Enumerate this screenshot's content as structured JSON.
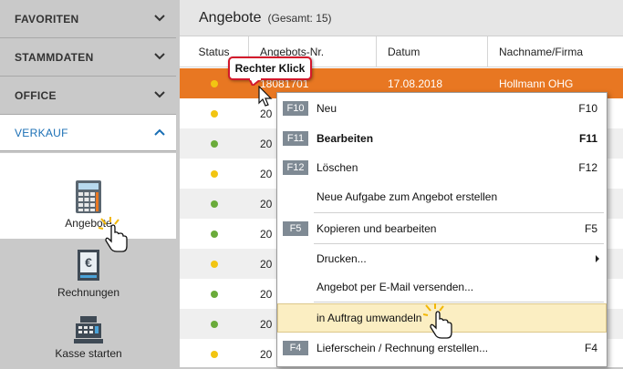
{
  "sidebar": {
    "sections": [
      {
        "label": "FAVORITEN"
      },
      {
        "label": "STAMMDATEN"
      },
      {
        "label": "OFFICE"
      }
    ],
    "active_section": {
      "label": "VERKAUF"
    },
    "tiles": {
      "angebote": {
        "label": "Angebote",
        "icon": "calculator-icon"
      },
      "rechnungen": {
        "label": "Rechnungen",
        "icon": "invoice-euro-icon"
      },
      "kasse": {
        "label": "Kasse starten",
        "icon": "cash-register-icon"
      }
    }
  },
  "main": {
    "title": "Angebote",
    "count": "(Gesamt: 15)",
    "columns": [
      "Status",
      "Angebots-Nr.",
      "Datum",
      "Nachname/Firma"
    ],
    "rows": [
      {
        "status": "yellow",
        "nr": "18081701",
        "date": "17.08.2018",
        "name": "Hollmann OHG",
        "selected": true
      },
      {
        "status": "yellow",
        "nr": "20",
        "date": "",
        "name": ""
      },
      {
        "status": "green",
        "nr": "20",
        "date": "",
        "name": ""
      },
      {
        "status": "yellow",
        "nr": "20",
        "date": "",
        "name": ""
      },
      {
        "status": "green",
        "nr": "20",
        "date": "",
        "name": ""
      },
      {
        "status": "green",
        "nr": "20",
        "date": "",
        "name": ""
      },
      {
        "status": "yellow",
        "nr": "20",
        "date": "",
        "name": ""
      },
      {
        "status": "green",
        "nr": "20",
        "date": "",
        "name": ""
      },
      {
        "status": "green",
        "nr": "20",
        "date": "",
        "name": ""
      },
      {
        "status": "yellow",
        "nr": "20",
        "date": "",
        "name": ""
      }
    ]
  },
  "context_menu": {
    "items": [
      {
        "key": "F10",
        "label": "Neu",
        "shortcut": "F10"
      },
      {
        "key": "F11",
        "label": "Bearbeiten",
        "shortcut": "F11"
      },
      {
        "key": "F12",
        "label": "Löschen",
        "shortcut": "F12"
      },
      {
        "key": "",
        "label": "Neue Aufgabe zum Angebot erstellen",
        "shortcut": ""
      },
      {
        "key": "F5",
        "label": "Kopieren und bearbeiten",
        "shortcut": "F5"
      },
      {
        "key": "",
        "label": "Drucken...",
        "shortcut": ""
      },
      {
        "key": "",
        "label": "Angebot per E-Mail versenden...",
        "shortcut": ""
      },
      {
        "key": "",
        "label": "in Auftrag umwandeln",
        "shortcut": ""
      },
      {
        "key": "F4",
        "label": "Lieferschein / Rechnung erstellen...",
        "shortcut": "F4"
      }
    ]
  },
  "callout": {
    "label": "Rechter Klick"
  },
  "colors": {
    "accent_orange": "#e87722",
    "link_blue": "#1a6fb5",
    "callout_red": "#d3182b",
    "status_yellow": "#f2c512",
    "status_green": "#6aab3a",
    "highlight": "#fbeec2"
  }
}
